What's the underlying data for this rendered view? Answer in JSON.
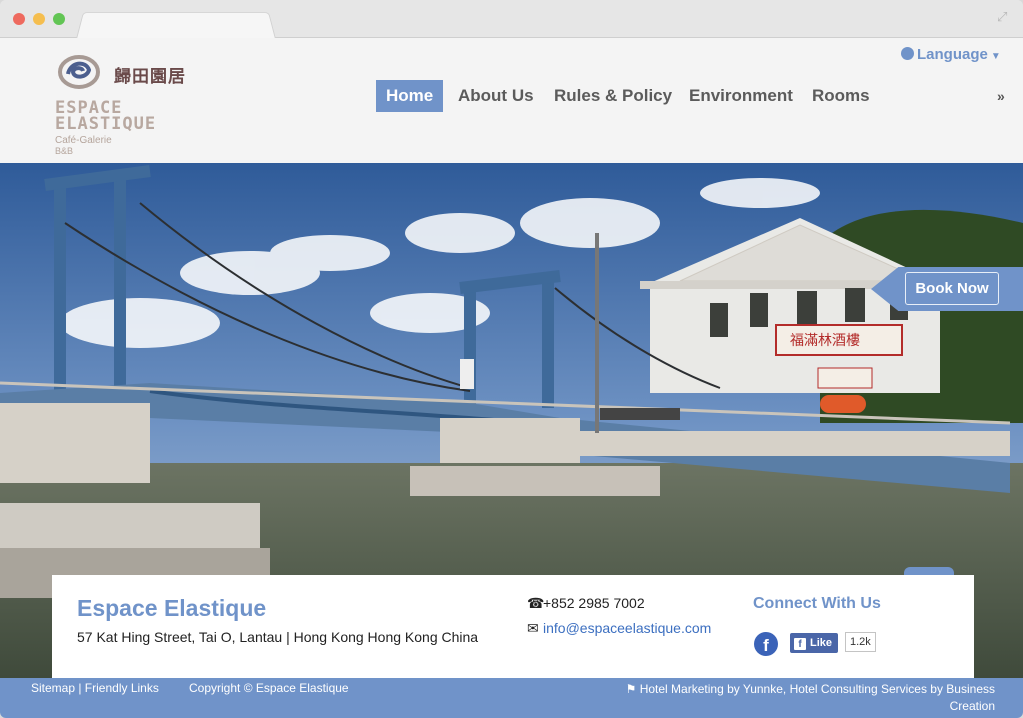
{
  "header": {
    "logo_cn": "歸田園居",
    "logo_line1": "ESPACE",
    "logo_line2": "ELASTIQUE",
    "logo_line3": "Café-Galerie",
    "logo_line4": "B&B",
    "language_label": "Language",
    "nav": [
      {
        "label": "Home"
      },
      {
        "label": "About Us"
      },
      {
        "label": "Rules & Policy"
      },
      {
        "label": "Environment"
      },
      {
        "label": "Rooms"
      }
    ],
    "more_label": "»"
  },
  "hero": {
    "book_label": "Book Now",
    "sign_text": "福滿林酒樓"
  },
  "contact": {
    "name": "Espace Elastique",
    "address": "57 Kat Hing Street, Tai O, Lantau | Hong Kong   Hong Kong China",
    "phone": "+852 2985 7002",
    "email": "info@espaceelastique.com",
    "connect_title": "Connect With Us",
    "like_label": "Like",
    "like_count": "1.2k",
    "to_top": "▲"
  },
  "footer": {
    "links": "Sitemap | Friendly Links",
    "copyright": "Copyright © Espace Elastique",
    "credit": "Hotel Marketing by Yunnke, Hotel Consulting Services by Business Creation"
  },
  "colors": {
    "accent": "#7093c9",
    "header_bg": "#f4f4f4"
  }
}
